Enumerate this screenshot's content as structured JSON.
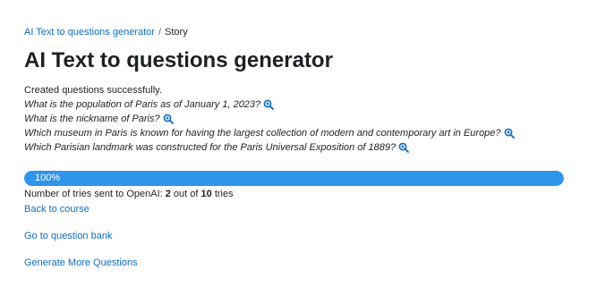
{
  "breadcrumb": {
    "parent": "AI Text to questions generator",
    "separator": "/",
    "current": "Story"
  },
  "page_title": "AI Text to questions generator",
  "status_message": "Created questions successfully.",
  "questions": [
    "What is the population of Paris as of January 1, 2023?",
    "What is the nickname of Paris?",
    "Which museum in Paris is known for having the largest collection of modern and contemporary art in Europe?",
    "Which Parisian landmark was constructed for the Paris Universal Exposition of 1889?"
  ],
  "question_icon": "magnifier-zoom-icon",
  "progress": {
    "value_percent": 100,
    "label": "100%"
  },
  "tries": {
    "prefix": "Number of tries sent to OpenAI: ",
    "count": "2",
    "middle": " out of ",
    "total": "10",
    "suffix": " tries"
  },
  "links": {
    "back": "Back to course",
    "bank": "Go to question bank",
    "more": "Generate More Questions"
  },
  "colors": {
    "link": "#0f6cbf",
    "progress_fill": "#2f95eb",
    "text": "#1d2125"
  }
}
